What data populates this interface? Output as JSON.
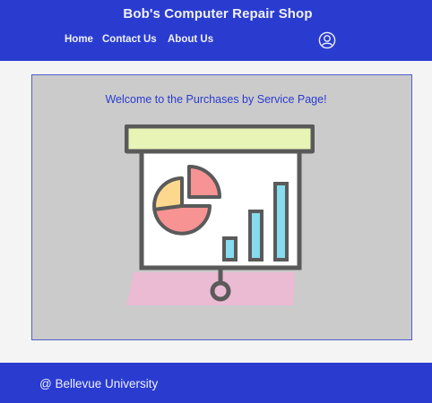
{
  "header": {
    "title": "Bob's Computer Repair Shop",
    "nav": [
      {
        "label": "Home"
      },
      {
        "label": "Contact Us"
      },
      {
        "label": "About Us"
      }
    ],
    "user_icon": "user-circle-icon"
  },
  "main": {
    "welcome_text": "Welcome to the Purchases by Service Page!",
    "illustration_icon": "presentation-chart-icon"
  },
  "footer": {
    "text": "@ Bellevue University"
  },
  "colors": {
    "brand_blue": "#2a3cd0",
    "page_bg": "#f4f4f4",
    "card_bg": "#cbcbcb"
  }
}
